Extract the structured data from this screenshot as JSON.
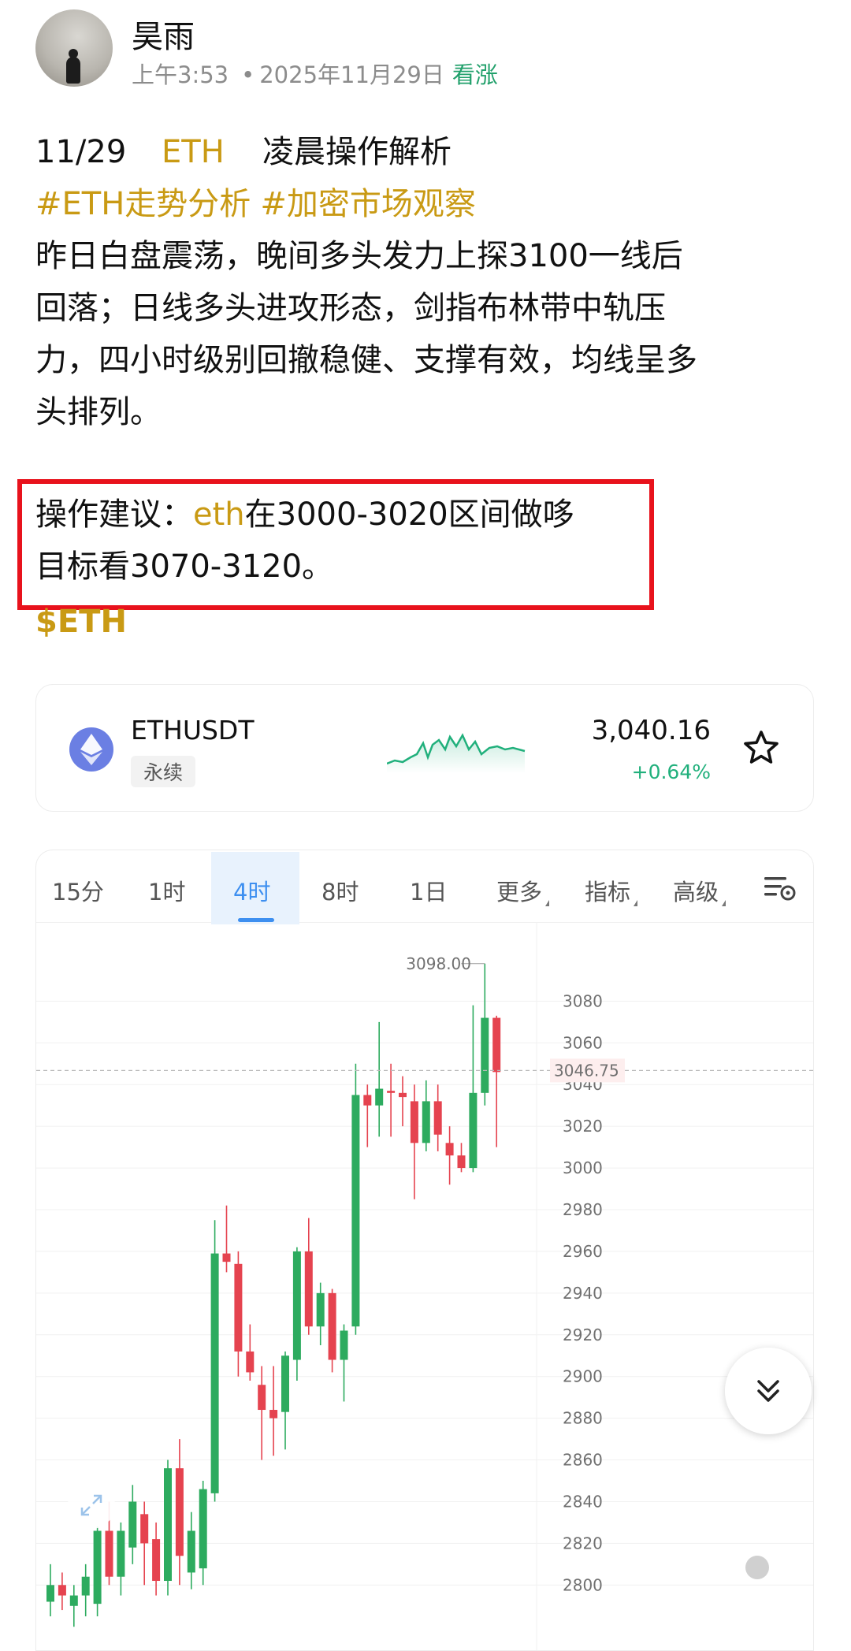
{
  "author": {
    "name": "昊雨",
    "time": "上午3:53",
    "date": "2025年11月29日",
    "sentiment": "看涨"
  },
  "post": {
    "title_date": "11/29",
    "title_coin": "ETH",
    "title_text": "凌晨操作解析",
    "tags": [
      "#ETH走势分析",
      "#加密市场观察"
    ],
    "body_lines": [
      "昨日白盘震荡，晚间多头发力上探3100一线后",
      "回落；日线多头进攻形态，剑指布林带中轨压",
      "力，四小时级别回撤稳健、支撑有效，均线呈多",
      "头排列。"
    ],
    "advice_prefix": "操作建议：",
    "advice_coin": "eth",
    "advice_rest": "在3000-3020区间做哆",
    "advice_line2": "目标看3070-3120。",
    "cashtag": "$ETH"
  },
  "ticker": {
    "pair": "ETHUSDT",
    "type": "永续",
    "price": "3,040.16",
    "change": "+0.64%",
    "up_color": "#21b07c"
  },
  "chart_tabs": [
    "15分",
    "1时",
    "4时",
    "8时",
    "1日",
    "更多",
    "指标",
    "高级"
  ],
  "active_tab": "4时",
  "chart_data": {
    "type": "candlestick",
    "interval": "4时",
    "y_ticks": [
      "3080",
      "3060",
      "3040",
      "3020",
      "3000",
      "2980",
      "2960",
      "2940",
      "2920",
      "2900",
      "2880",
      "2860",
      "2840",
      "2820",
      "2800"
    ],
    "ylim": [
      2785,
      3110
    ],
    "high_label": "3098.00",
    "last_price_label": "3046.75",
    "up_color": "#2dab5f",
    "down_color": "#e5434f",
    "candles": [
      {
        "o": 2792,
        "h": 2810,
        "l": 2785,
        "c": 2800
      },
      {
        "o": 2800,
        "h": 2806,
        "l": 2788,
        "c": 2795
      },
      {
        "o": 2790,
        "h": 2800,
        "l": 2780,
        "c": 2795
      },
      {
        "o": 2795,
        "h": 2810,
        "l": 2785,
        "c": 2804
      },
      {
        "o": 2791,
        "h": 2828,
        "l": 2785,
        "c": 2826
      },
      {
        "o": 2826,
        "h": 2840,
        "l": 2800,
        "c": 2804
      },
      {
        "o": 2804,
        "h": 2830,
        "l": 2795,
        "c": 2826
      },
      {
        "o": 2818,
        "h": 2848,
        "l": 2810,
        "c": 2840
      },
      {
        "o": 2834,
        "h": 2840,
        "l": 2800,
        "c": 2820
      },
      {
        "o": 2822,
        "h": 2830,
        "l": 2795,
        "c": 2802
      },
      {
        "o": 2802,
        "h": 2860,
        "l": 2795,
        "c": 2856
      },
      {
        "o": 2856,
        "h": 2870,
        "l": 2800,
        "c": 2814
      },
      {
        "o": 2806,
        "h": 2835,
        "l": 2798,
        "c": 2826
      },
      {
        "o": 2808,
        "h": 2850,
        "l": 2800,
        "c": 2846
      },
      {
        "o": 2844,
        "h": 2975,
        "l": 2840,
        "c": 2959
      },
      {
        "o": 2959,
        "h": 2982,
        "l": 2950,
        "c": 2955
      },
      {
        "o": 2954,
        "h": 2960,
        "l": 2900,
        "c": 2912
      },
      {
        "o": 2912,
        "h": 2925,
        "l": 2898,
        "c": 2902
      },
      {
        "o": 2896,
        "h": 2905,
        "l": 2860,
        "c": 2884
      },
      {
        "o": 2884,
        "h": 2905,
        "l": 2862,
        "c": 2880
      },
      {
        "o": 2883,
        "h": 2912,
        "l": 2865,
        "c": 2910
      },
      {
        "o": 2908,
        "h": 2962,
        "l": 2898,
        "c": 2960
      },
      {
        "o": 2960,
        "h": 2976,
        "l": 2920,
        "c": 2924
      },
      {
        "o": 2924,
        "h": 2945,
        "l": 2915,
        "c": 2940
      },
      {
        "o": 2940,
        "h": 2942,
        "l": 2902,
        "c": 2908
      },
      {
        "o": 2908,
        "h": 2925,
        "l": 2888,
        "c": 2922
      },
      {
        "o": 2924,
        "h": 3050,
        "l": 2920,
        "c": 3035
      },
      {
        "o": 3035,
        "h": 3040,
        "l": 3010,
        "c": 3030
      },
      {
        "o": 3030,
        "h": 3070,
        "l": 3015,
        "c": 3038
      },
      {
        "o": 3037,
        "h": 3050,
        "l": 3015,
        "c": 3036
      },
      {
        "o": 3036,
        "h": 3044,
        "l": 3020,
        "c": 3034
      },
      {
        "o": 3032,
        "h": 3040,
        "l": 2985,
        "c": 3012
      },
      {
        "o": 3012,
        "h": 3042,
        "l": 3008,
        "c": 3032
      },
      {
        "o": 3032,
        "h": 3040,
        "l": 3008,
        "c": 3016
      },
      {
        "o": 3012,
        "h": 3020,
        "l": 2992,
        "c": 3006
      },
      {
        "o": 3006,
        "h": 3012,
        "l": 2998,
        "c": 3000
      },
      {
        "o": 3000,
        "h": 3078,
        "l": 2998,
        "c": 3036
      },
      {
        "o": 3036,
        "h": 3098,
        "l": 3030,
        "c": 3072
      },
      {
        "o": 3072,
        "h": 3073,
        "l": 3010,
        "c": 3046
      }
    ]
  }
}
